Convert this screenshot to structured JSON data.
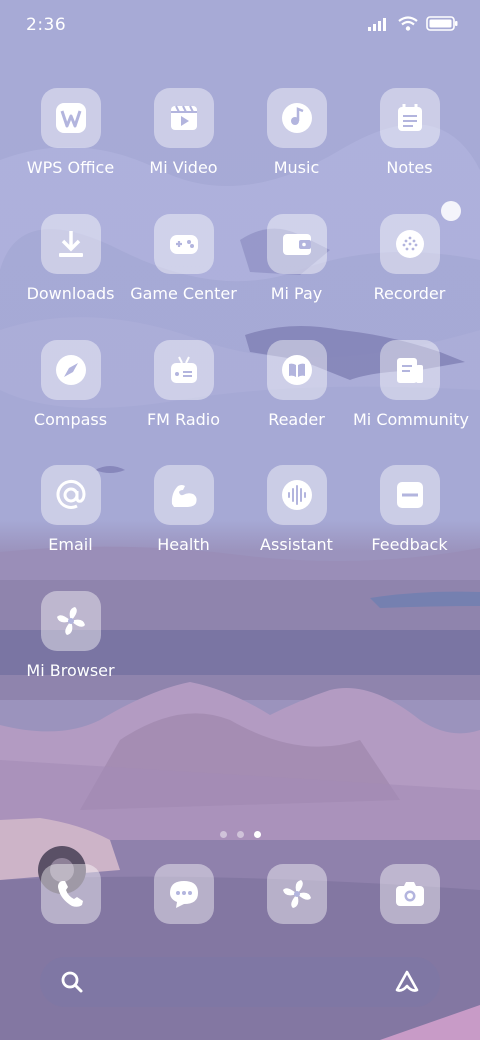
{
  "status_bar": {
    "time": "2:36"
  },
  "apps": [
    {
      "label": "WPS Office",
      "icon": "wps-office-icon"
    },
    {
      "label": "Mi Video",
      "icon": "video-icon"
    },
    {
      "label": "Music",
      "icon": "music-icon"
    },
    {
      "label": "Notes",
      "icon": "notes-icon"
    },
    {
      "label": "Downloads",
      "icon": "download-icon"
    },
    {
      "label": "Game Center",
      "icon": "gamepad-icon"
    },
    {
      "label": "Mi Pay",
      "icon": "wallet-icon"
    },
    {
      "label": "Recorder",
      "icon": "recorder-icon"
    },
    {
      "label": "Compass",
      "icon": "compass-icon"
    },
    {
      "label": "FM Radio",
      "icon": "radio-icon"
    },
    {
      "label": "Reader",
      "icon": "book-icon"
    },
    {
      "label": "Mi Community",
      "icon": "community-icon"
    },
    {
      "label": "Email",
      "icon": "at-sign-icon"
    },
    {
      "label": "Health",
      "icon": "bicep-icon"
    },
    {
      "label": "Assistant",
      "icon": "voice-wave-icon"
    },
    {
      "label": "Feedback",
      "icon": "feedback-icon"
    },
    {
      "label": "Mi Browser",
      "icon": "browser-icon"
    }
  ],
  "page_indicator": {
    "pages": 3,
    "active": 2
  },
  "dock": [
    {
      "icon": "phone-icon"
    },
    {
      "icon": "messages-icon"
    },
    {
      "icon": "browser-icon"
    },
    {
      "icon": "camera-icon"
    }
  ],
  "search_bar": {
    "left_icon": "search-icon",
    "right_icon": "assistant-logo-icon"
  }
}
